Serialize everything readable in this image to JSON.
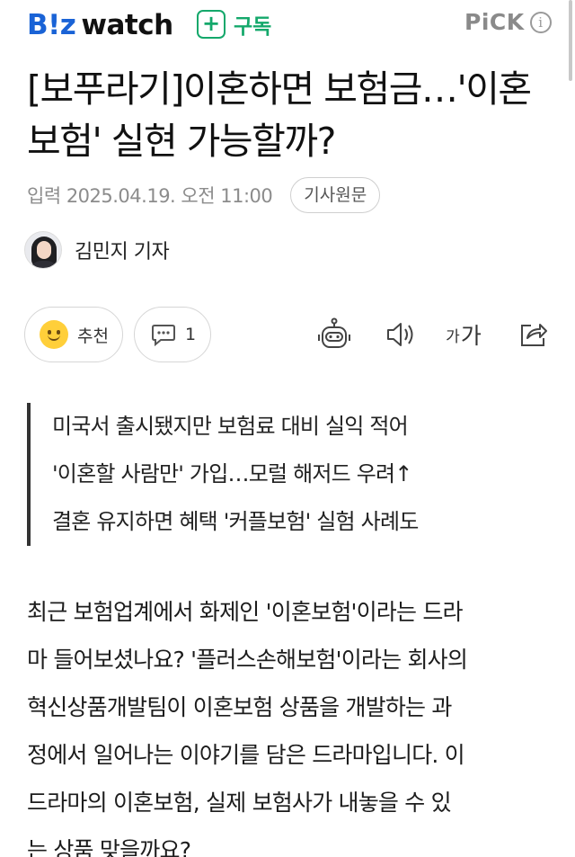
{
  "header": {
    "logo_biz": "B!z",
    "logo_watch": "watch",
    "subscribe_label": "구독",
    "subscribe_icon": "+",
    "pick_label": "PiCK",
    "info_icon": "i"
  },
  "article": {
    "title": "[보푸라기]이혼하면 보험금…'이혼보험' 실현 가능할까?",
    "date": "입력 2025.04.19. 오전 11:00",
    "origin_button": "기사원문",
    "reporter": "김민지 기자"
  },
  "actions": {
    "like_label": "추천",
    "comment_count": "1",
    "font_small": "가",
    "font_large": "가"
  },
  "summary": [
    "미국서 출시됐지만 보험료 대비 실익 적어",
    "'이혼할 사람만' 가입…모럴 해저드 우려↑",
    "결혼 유지하면 혜택 '커플보험' 실험 사례도"
  ],
  "body_lines": [
    "최근 보험업계에서 화제인 '이혼보험'이라는 드라",
    "마 들어보셨나요? '플러스손해보험'이라는 회사의",
    "혁신상품개발팀이 이혼보험 상품을 개발하는 과",
    "정에서 일어나는 이야기를 담은 드라마입니다. 이",
    "드라마의 이혼보험, 실제 보험사가 내놓을 수 있",
    "는 상품 맞을까요?"
  ],
  "colors": {
    "brand_blue": "#1a63d6",
    "subscribe_green": "#14a86b"
  }
}
